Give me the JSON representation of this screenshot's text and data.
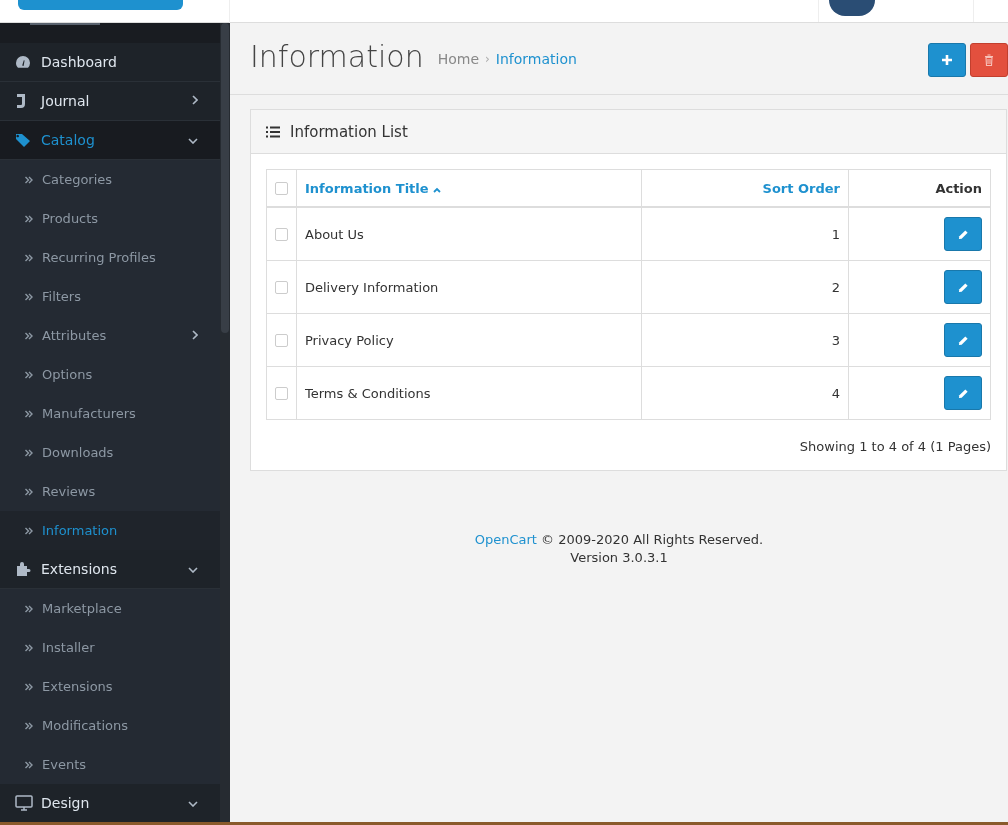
{
  "sidebar": {
    "items": [
      {
        "label": "Dashboard",
        "selected": false
      },
      {
        "label": "Journal",
        "selected": false,
        "expanded": false
      },
      {
        "label": "Catalog",
        "selected": true,
        "expanded": true,
        "children": [
          {
            "label": "Categories",
            "selected": false
          },
          {
            "label": "Products",
            "selected": false
          },
          {
            "label": "Recurring Profiles",
            "selected": false
          },
          {
            "label": "Filters",
            "selected": false
          },
          {
            "label": "Attributes",
            "selected": false,
            "expanded": false
          },
          {
            "label": "Options",
            "selected": false
          },
          {
            "label": "Manufacturers",
            "selected": false
          },
          {
            "label": "Downloads",
            "selected": false
          },
          {
            "label": "Reviews",
            "selected": false
          },
          {
            "label": "Information",
            "selected": true
          }
        ]
      },
      {
        "label": "Extensions",
        "selected": false,
        "expanded": true,
        "children": [
          {
            "label": "Marketplace",
            "selected": false
          },
          {
            "label": "Installer",
            "selected": false
          },
          {
            "label": "Extensions",
            "selected": false
          },
          {
            "label": "Modifications",
            "selected": false
          },
          {
            "label": "Events",
            "selected": false
          }
        ]
      },
      {
        "label": "Design",
        "selected": false,
        "expanded": true
      }
    ]
  },
  "page": {
    "title": "Information",
    "separator": "›",
    "breadcrumb": [
      {
        "label": "Home",
        "selected": false
      },
      {
        "label": "Information",
        "selected": true
      }
    ]
  },
  "panel": {
    "title": "Information List",
    "table": {
      "select_all_checked": false,
      "columns": [
        {
          "label": "Information Title",
          "sorted": true
        },
        {
          "label": "Sort Order",
          "sorted": false
        },
        {
          "label": "Action"
        }
      ],
      "rows": [
        {
          "title": "About Us",
          "sort_order": "1",
          "checked": false
        },
        {
          "title": "Delivery Information",
          "sort_order": "2",
          "checked": false
        },
        {
          "title": "Privacy Policy",
          "sort_order": "3",
          "checked": false
        },
        {
          "title": "Terms & Conditions",
          "sort_order": "4",
          "checked": false
        }
      ]
    },
    "pagination_text": "Showing 1 to 4 of 4 (1 Pages)"
  },
  "footer": {
    "brand": "OpenCart",
    "copyright": "© 2009-2020 All Rights Reserved.",
    "version": "Version 3.0.3.1"
  }
}
